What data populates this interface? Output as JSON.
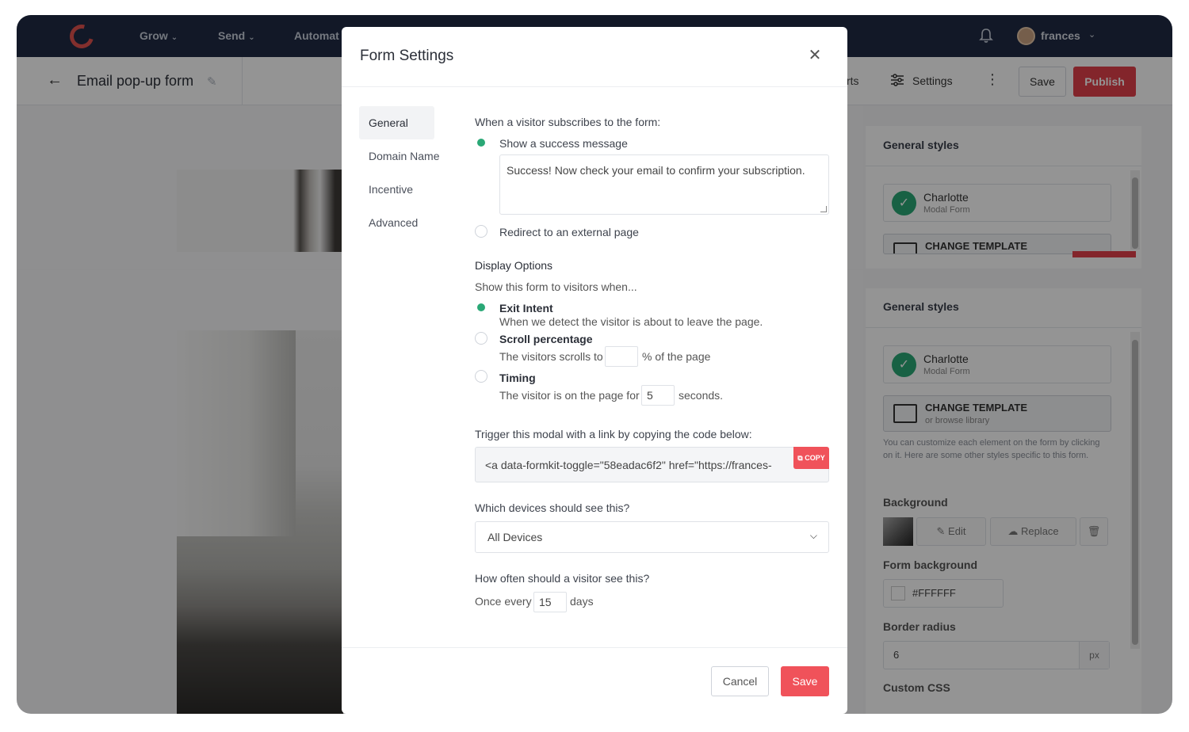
{
  "app": {
    "nav": {
      "grow": "Grow",
      "send": "Send",
      "automate": "Automat",
      "username": "frances"
    },
    "header": {
      "back_icon": "arrow-left-icon",
      "title": "Email pop-up form",
      "edit_icon": "pencil-icon",
      "reports_partial": "rts",
      "settings_label": "Settings",
      "save_label": "Save",
      "publish_label": "Publish"
    },
    "right_panel": {
      "section_a_title": "General styles",
      "section_b_title": "General styles",
      "template_name": "Charlotte",
      "template_type": "Modal Form",
      "change_template": "CHANGE TEMPLATE",
      "browse_library": "or browse library",
      "note": "You can customize each element on the form by clicking on it. Here are some other styles specific to this form.",
      "background_label": "Background",
      "edit_label": "Edit",
      "replace_label": "Replace",
      "form_background_label": "Form background",
      "form_background_value": "#FFFFFF",
      "border_radius_label": "Border radius",
      "border_radius_value": "6",
      "border_radius_unit": "px",
      "custom_css_label": "Custom CSS"
    }
  },
  "modal": {
    "title": "Form Settings",
    "tabs": [
      "General",
      "Domain Name",
      "Incentive",
      "Advanced"
    ],
    "active_tab": "General",
    "subscribe_heading": "When a visitor subscribes to the form:",
    "option_success": "Show a success message",
    "success_message": "Success! Now check your email to confirm your subscription.",
    "option_redirect": "Redirect to an external page",
    "display_heading": "Display Options",
    "display_sub": "Show this form to visitors when...",
    "exit_intent_title": "Exit Intent",
    "exit_intent_desc": "When we detect the visitor is about to leave the page.",
    "scroll_title": "Scroll percentage",
    "scroll_prefix": "The visitors scrolls to",
    "scroll_value": "",
    "scroll_suffix": "% of the page",
    "timing_title": "Timing",
    "timing_prefix": "The visitor is on the page for",
    "timing_value": "5",
    "timing_suffix": "seconds.",
    "trigger_heading": "Trigger this modal with a link by copying the code below:",
    "trigger_code": "<a data-formkit-toggle=\"58eadac6f2\" href=\"https://frances-",
    "copy_label": "COPY",
    "devices_heading": "Which devices should see this?",
    "devices_value": "All Devices",
    "frequency_heading": "How often should a visitor see this?",
    "frequency_prefix": "Once every",
    "frequency_value": "15",
    "frequency_suffix": "days",
    "cancel_label": "Cancel",
    "save_label": "Save",
    "close_icon": "close-icon",
    "success_selected": true,
    "display_selected": "Exit Intent",
    "accent_color": "#2aa876",
    "primary_color": "#f0525a"
  }
}
